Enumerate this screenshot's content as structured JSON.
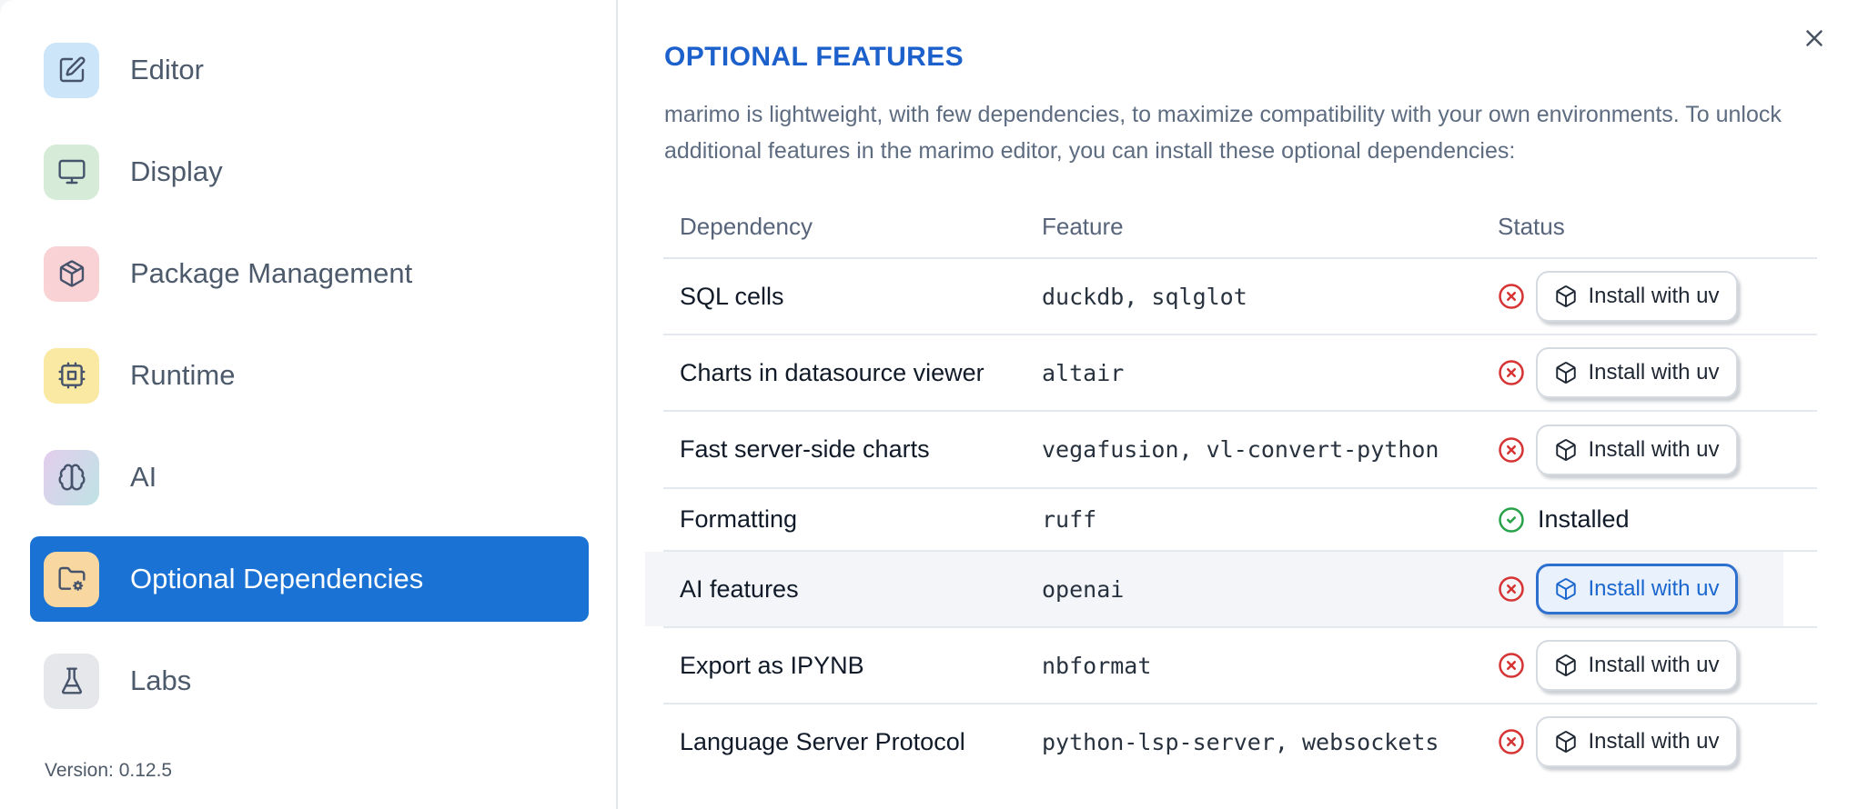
{
  "theme": {
    "accent": "#1a73d4",
    "title-blue": "#1c60cb",
    "error-red": "#d63434",
    "success-green": "#27a249",
    "row-highlight": "#f3f5f8"
  },
  "sidebar": {
    "items": [
      {
        "label": "Editor",
        "icon": "edit-icon",
        "icon_bg": "#cde5f8"
      },
      {
        "label": "Display",
        "icon": "monitor-icon",
        "icon_bg": "#d6ebd8"
      },
      {
        "label": "Package Management",
        "icon": "package-icon",
        "icon_bg": "#f9d2d6"
      },
      {
        "label": "Runtime",
        "icon": "cpu-icon",
        "icon_bg": "#fae9a2"
      },
      {
        "label": "AI",
        "icon": "brain-icon",
        "icon_bg": "linear-gradient(120deg, #e3cdee 0%, #bfe3e4 100%)"
      },
      {
        "label": "Optional Dependencies",
        "icon": "folder-cog-icon",
        "icon_bg": "#f8d8a0",
        "selected": true
      },
      {
        "label": "Labs",
        "icon": "flask-icon",
        "icon_bg": "#e6e7ea"
      }
    ],
    "version": "Version: 0.12.5"
  },
  "dialog": {
    "title": "OPTIONAL FEATURES",
    "description": "marimo is lightweight, with few dependencies, to maximize compatibility with your own environments. To unlock additional features in the marimo editor, you can install these optional dependencies:"
  },
  "table": {
    "columns": [
      "Dependency",
      "Feature",
      "Status"
    ],
    "rows": [
      {
        "dependency": "SQL cells",
        "feature": "duckdb, sqlglot",
        "status": "not-installed",
        "action": "Install with uv"
      },
      {
        "dependency": "Charts in datasource viewer",
        "feature": "altair",
        "status": "not-installed",
        "action": "Install with uv"
      },
      {
        "dependency": "Fast server-side charts",
        "feature": "vegafusion, vl-convert-python",
        "status": "not-installed",
        "action": "Install with uv"
      },
      {
        "dependency": "Formatting",
        "feature": "ruff",
        "status": "installed",
        "status_label": "Installed"
      },
      {
        "dependency": "AI features",
        "feature": "openai",
        "status": "not-installed",
        "action": "Install with uv",
        "highlighted": true,
        "button_focused": true
      },
      {
        "dependency": "Export as IPYNB",
        "feature": "nbformat",
        "status": "not-installed",
        "action": "Install with uv"
      },
      {
        "dependency": "Language Server Protocol",
        "feature": "python-lsp-server, websockets",
        "status": "not-installed",
        "action": "Install with uv"
      }
    ]
  }
}
